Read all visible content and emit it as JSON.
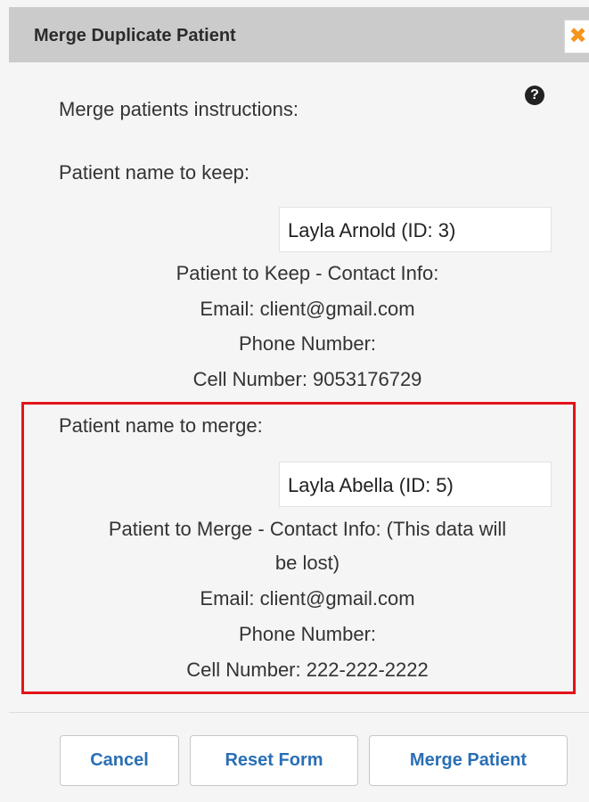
{
  "dialog": {
    "title": "Merge Duplicate Patient",
    "close_glyph": "✖"
  },
  "instructions": {
    "label": "Merge patients instructions:",
    "help_glyph": "?"
  },
  "keep": {
    "label": "Patient name to keep:",
    "value": "Layla Arnold (ID: 3)",
    "contact_header": "Patient to Keep - Contact Info:",
    "email": "Email: client@gmail.com",
    "phone": "Phone Number:",
    "cell": "Cell Number: 9053176729"
  },
  "merge": {
    "label": "Patient name to merge:",
    "value": "Layla Abella (ID: 5)",
    "contact_header_line1": "Patient to Merge - Contact Info: (This data will",
    "contact_header_line2": "be lost)",
    "email": "Email: client@gmail.com",
    "phone": "Phone Number:",
    "cell": "Cell Number: 222-222-2222"
  },
  "buttons": {
    "cancel": "Cancel",
    "reset": "Reset Form",
    "merge": "Merge Patient"
  },
  "colors": {
    "highlight_border": "#e2141b",
    "button_text": "#2a6fb5",
    "close_icon": "#f7941d",
    "titlebar": "#cbcbcb"
  },
  "icons": {
    "close": "close-icon",
    "help": "help-icon"
  }
}
